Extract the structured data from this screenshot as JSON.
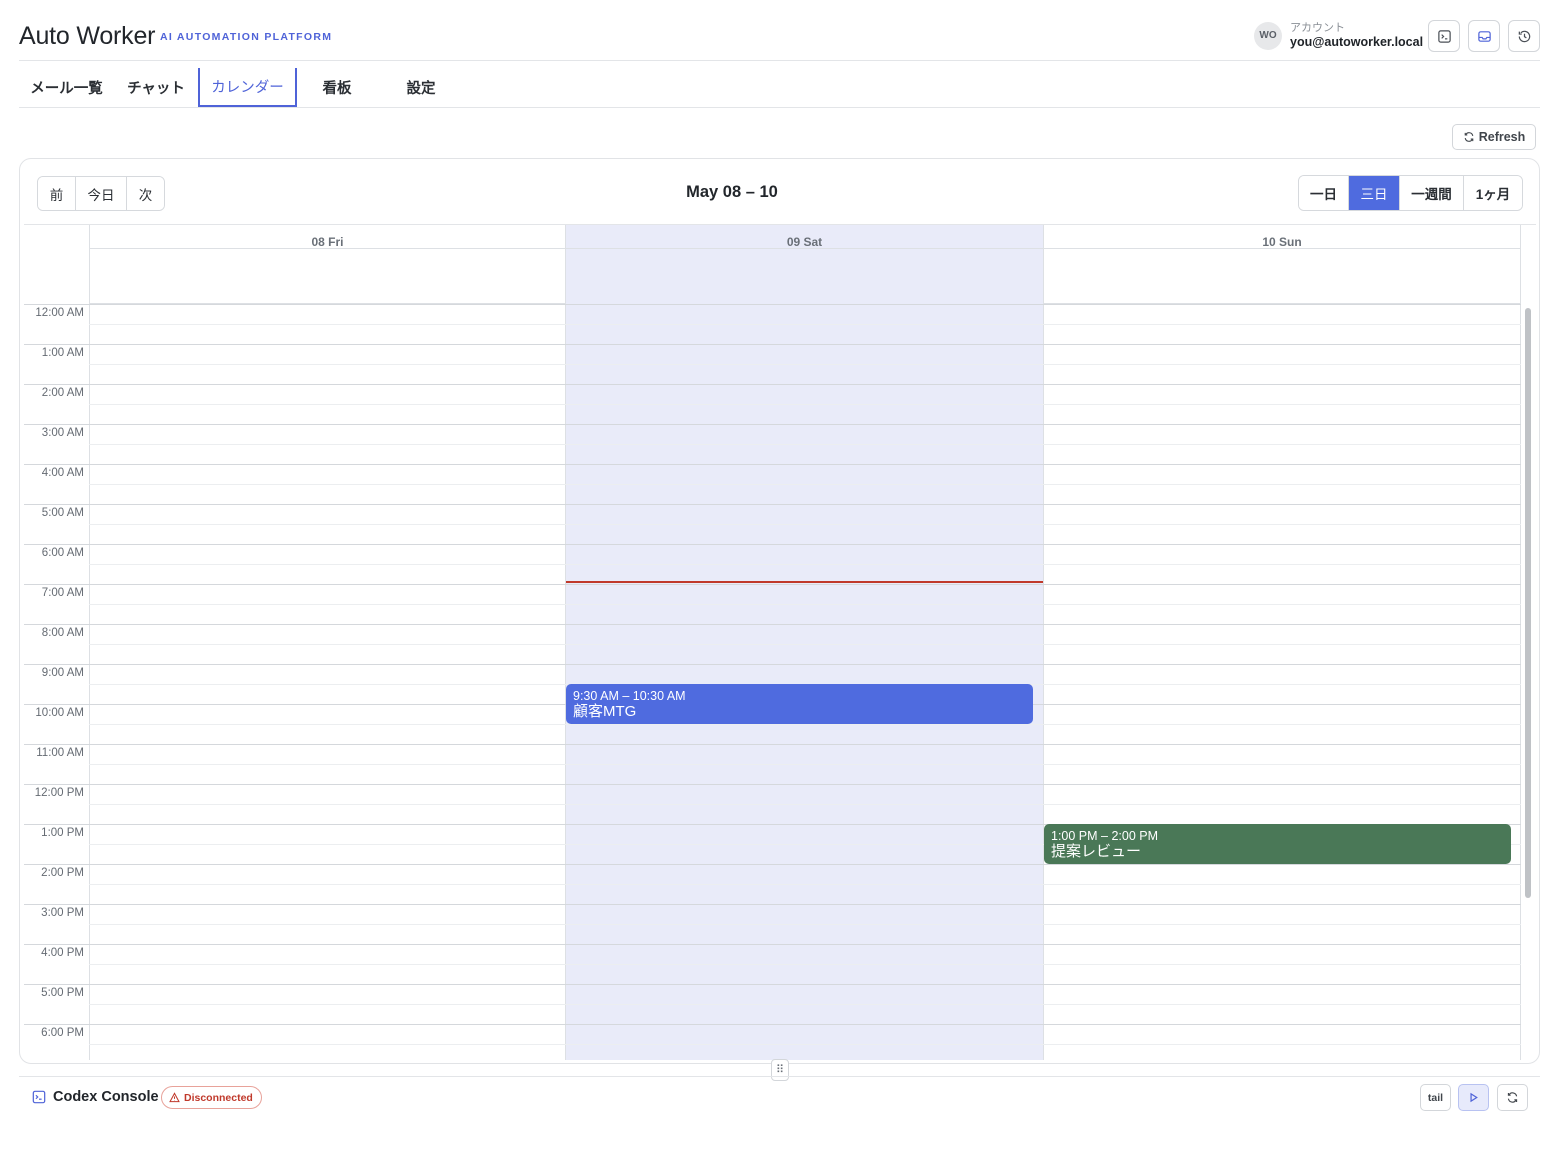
{
  "app": {
    "title": "Auto Worker",
    "subtitle": "AI AUTOMATION PLATFORM",
    "accent_color": "#4f63d8"
  },
  "account": {
    "initials": "WO",
    "label": "アカウント",
    "email": "you@autoworker.local"
  },
  "header_actions": [
    {
      "icon": "terminal-icon"
    },
    {
      "icon": "inbox-icon"
    },
    {
      "icon": "history-icon"
    }
  ],
  "tabs": [
    {
      "label": "メール一覧",
      "active": false
    },
    {
      "label": "チャット",
      "active": false
    },
    {
      "label": "カレンダー",
      "active": true
    },
    {
      "label": "看板",
      "active": false
    },
    {
      "label": "設定",
      "active": false
    }
  ],
  "toolbar": {
    "refresh_label": "Refresh"
  },
  "calendar": {
    "nav": {
      "prev": "前",
      "today": "今日",
      "next": "次"
    },
    "range_title": "May 08 – 10",
    "views": [
      {
        "label": "一日",
        "active": false
      },
      {
        "label": "三日",
        "active": true
      },
      {
        "label": "一週間",
        "active": false
      },
      {
        "label": "1ヶ月",
        "active": false
      }
    ],
    "days": [
      {
        "label": "08 Fri",
        "today": false
      },
      {
        "label": "09 Sat",
        "today": true
      },
      {
        "label": "10 Sun",
        "today": false
      }
    ],
    "hours": [
      "12:00 AM",
      "1:00 AM",
      "2:00 AM",
      "3:00 AM",
      "4:00 AM",
      "5:00 AM",
      "6:00 AM",
      "7:00 AM",
      "8:00 AM",
      "9:00 AM",
      "10:00 AM",
      "11:00 AM",
      "12:00 PM",
      "1:00 PM",
      "2:00 PM",
      "3:00 PM",
      "4:00 PM",
      "5:00 PM",
      "6:00 PM"
    ],
    "now_time": "7:05 AM",
    "events": [
      {
        "day": 1,
        "time": "9:30 AM – 10:30 AM",
        "title": "顧客MTG",
        "start": 9.5,
        "end": 10.5,
        "color": "#4f6bdf"
      },
      {
        "day": 2,
        "time": "1:00 PM – 2:00 PM",
        "title": "提案レビュー",
        "start": 13,
        "end": 14,
        "color": "#4a7857"
      }
    ],
    "now_color": "#c0392b",
    "today_bg": "#e9ebf9"
  },
  "console": {
    "title": "Codex Console",
    "status": "Disconnected",
    "status_color": "#c0392b",
    "tail_label": "tail"
  }
}
